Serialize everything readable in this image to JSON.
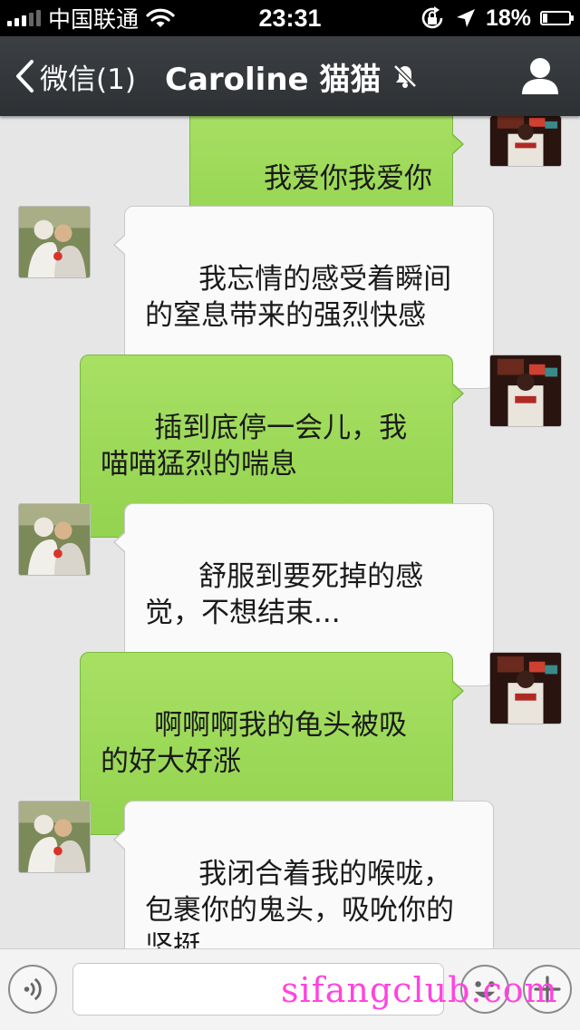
{
  "status_bar": {
    "carrier": "中国联通",
    "time": "23:31",
    "battery_percent": "18%",
    "battery_level": 0.18,
    "icons": [
      "signal-icon",
      "wifi-icon",
      "rotation-lock-icon",
      "location-icon",
      "battery-icon"
    ]
  },
  "nav": {
    "back_label": "微信(1)",
    "title": "Caroline 猫猫",
    "icons": [
      "back-chevron-icon",
      "mute-bell-icon",
      "profile-icon"
    ]
  },
  "messages": [
    {
      "side": "sent",
      "text": "我爱你我爱你"
    },
    {
      "side": "received",
      "text": "我忘情的感受着瞬间的窒息带来的强烈快感"
    },
    {
      "side": "sent",
      "text": "插到底停一会儿，我喵喵猛烈的喘息"
    },
    {
      "side": "received",
      "text": "舒服到要死掉的感觉，不想结束..."
    },
    {
      "side": "sent",
      "text": "啊啊啊我的龟头被吸的好大好涨"
    },
    {
      "side": "received",
      "text": "我闭合着我的喉咙，包裹你的鬼头，吸吮你的坚挺..."
    }
  ],
  "input_bar": {
    "placeholder": "",
    "icons": [
      "voice-icon",
      "emoji-icon",
      "plus-icon"
    ]
  },
  "watermark": "sifangclub.com",
  "colors": {
    "nav_bg": "#34373a",
    "sent_bubble": "#9edb58",
    "received_bubble": "#fafafa",
    "chat_bg": "#e6e6e6",
    "watermark": "#ff44e0"
  }
}
